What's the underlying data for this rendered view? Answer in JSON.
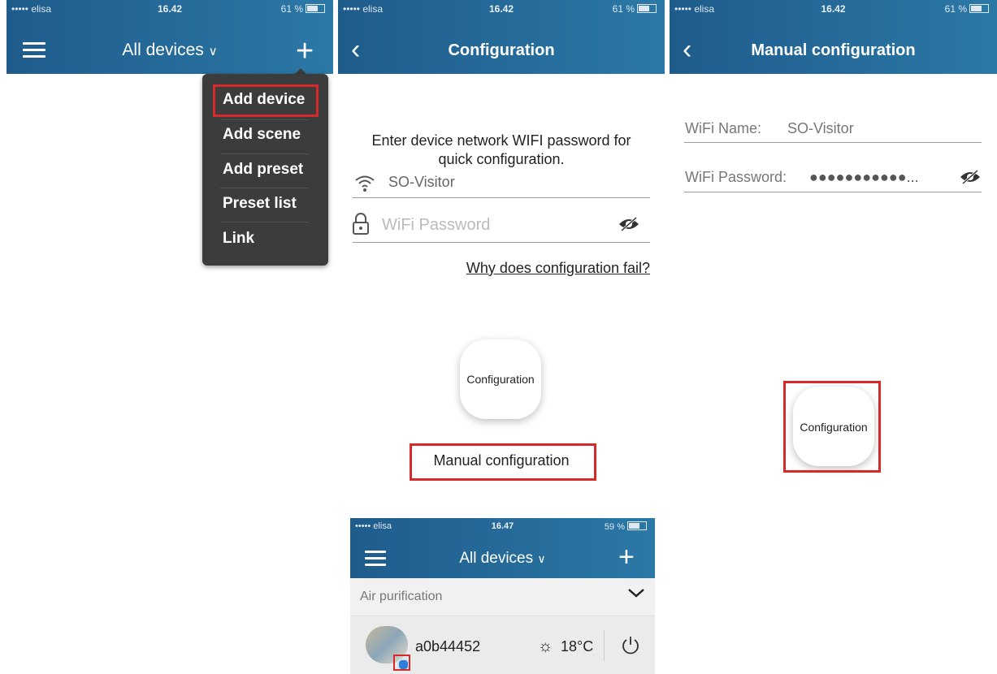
{
  "screen1": {
    "status": {
      "carrier": "••••• elisa",
      "time": "16.42",
      "battery": "61 %"
    },
    "title": "All devices",
    "menu": {
      "items": [
        "Add device",
        "Add scene",
        "Add preset",
        "Preset list",
        "Link"
      ]
    }
  },
  "screen2": {
    "status": {
      "carrier": "••••• elisa",
      "time": "16.42",
      "battery": "61 %"
    },
    "title": "Configuration",
    "instruction": "Enter device network WIFI password for quick configuration.",
    "ssid": "SO-Visitor",
    "password_placeholder": "WiFi Password",
    "help_link": "Why does configuration fail?",
    "config_button": "Configuration",
    "manual_link": "Manual configuration"
  },
  "screen3": {
    "status": {
      "carrier": "••••• elisa",
      "time": "16.42",
      "battery": "61 %"
    },
    "title": "Manual configuration",
    "wifi_name_label": "WiFi Name:",
    "wifi_name_value": "SO-Visitor",
    "wifi_password_label": "WiFi Password:",
    "wifi_password_value": "●●●●●●●●●●●...",
    "config_button": "Configuration"
  },
  "screen4": {
    "status": {
      "carrier": "••••• elisa",
      "time": "16.47",
      "battery": "59 %"
    },
    "title": "All devices",
    "group_label": "Air purification",
    "device": {
      "name": "a0b44452",
      "temperature": "18°C"
    }
  },
  "colors": {
    "header_start": "#1f5c8c",
    "header_end": "#2b78a6",
    "highlight": "#d62a2a",
    "menu_bg": "#3c3c3c"
  }
}
